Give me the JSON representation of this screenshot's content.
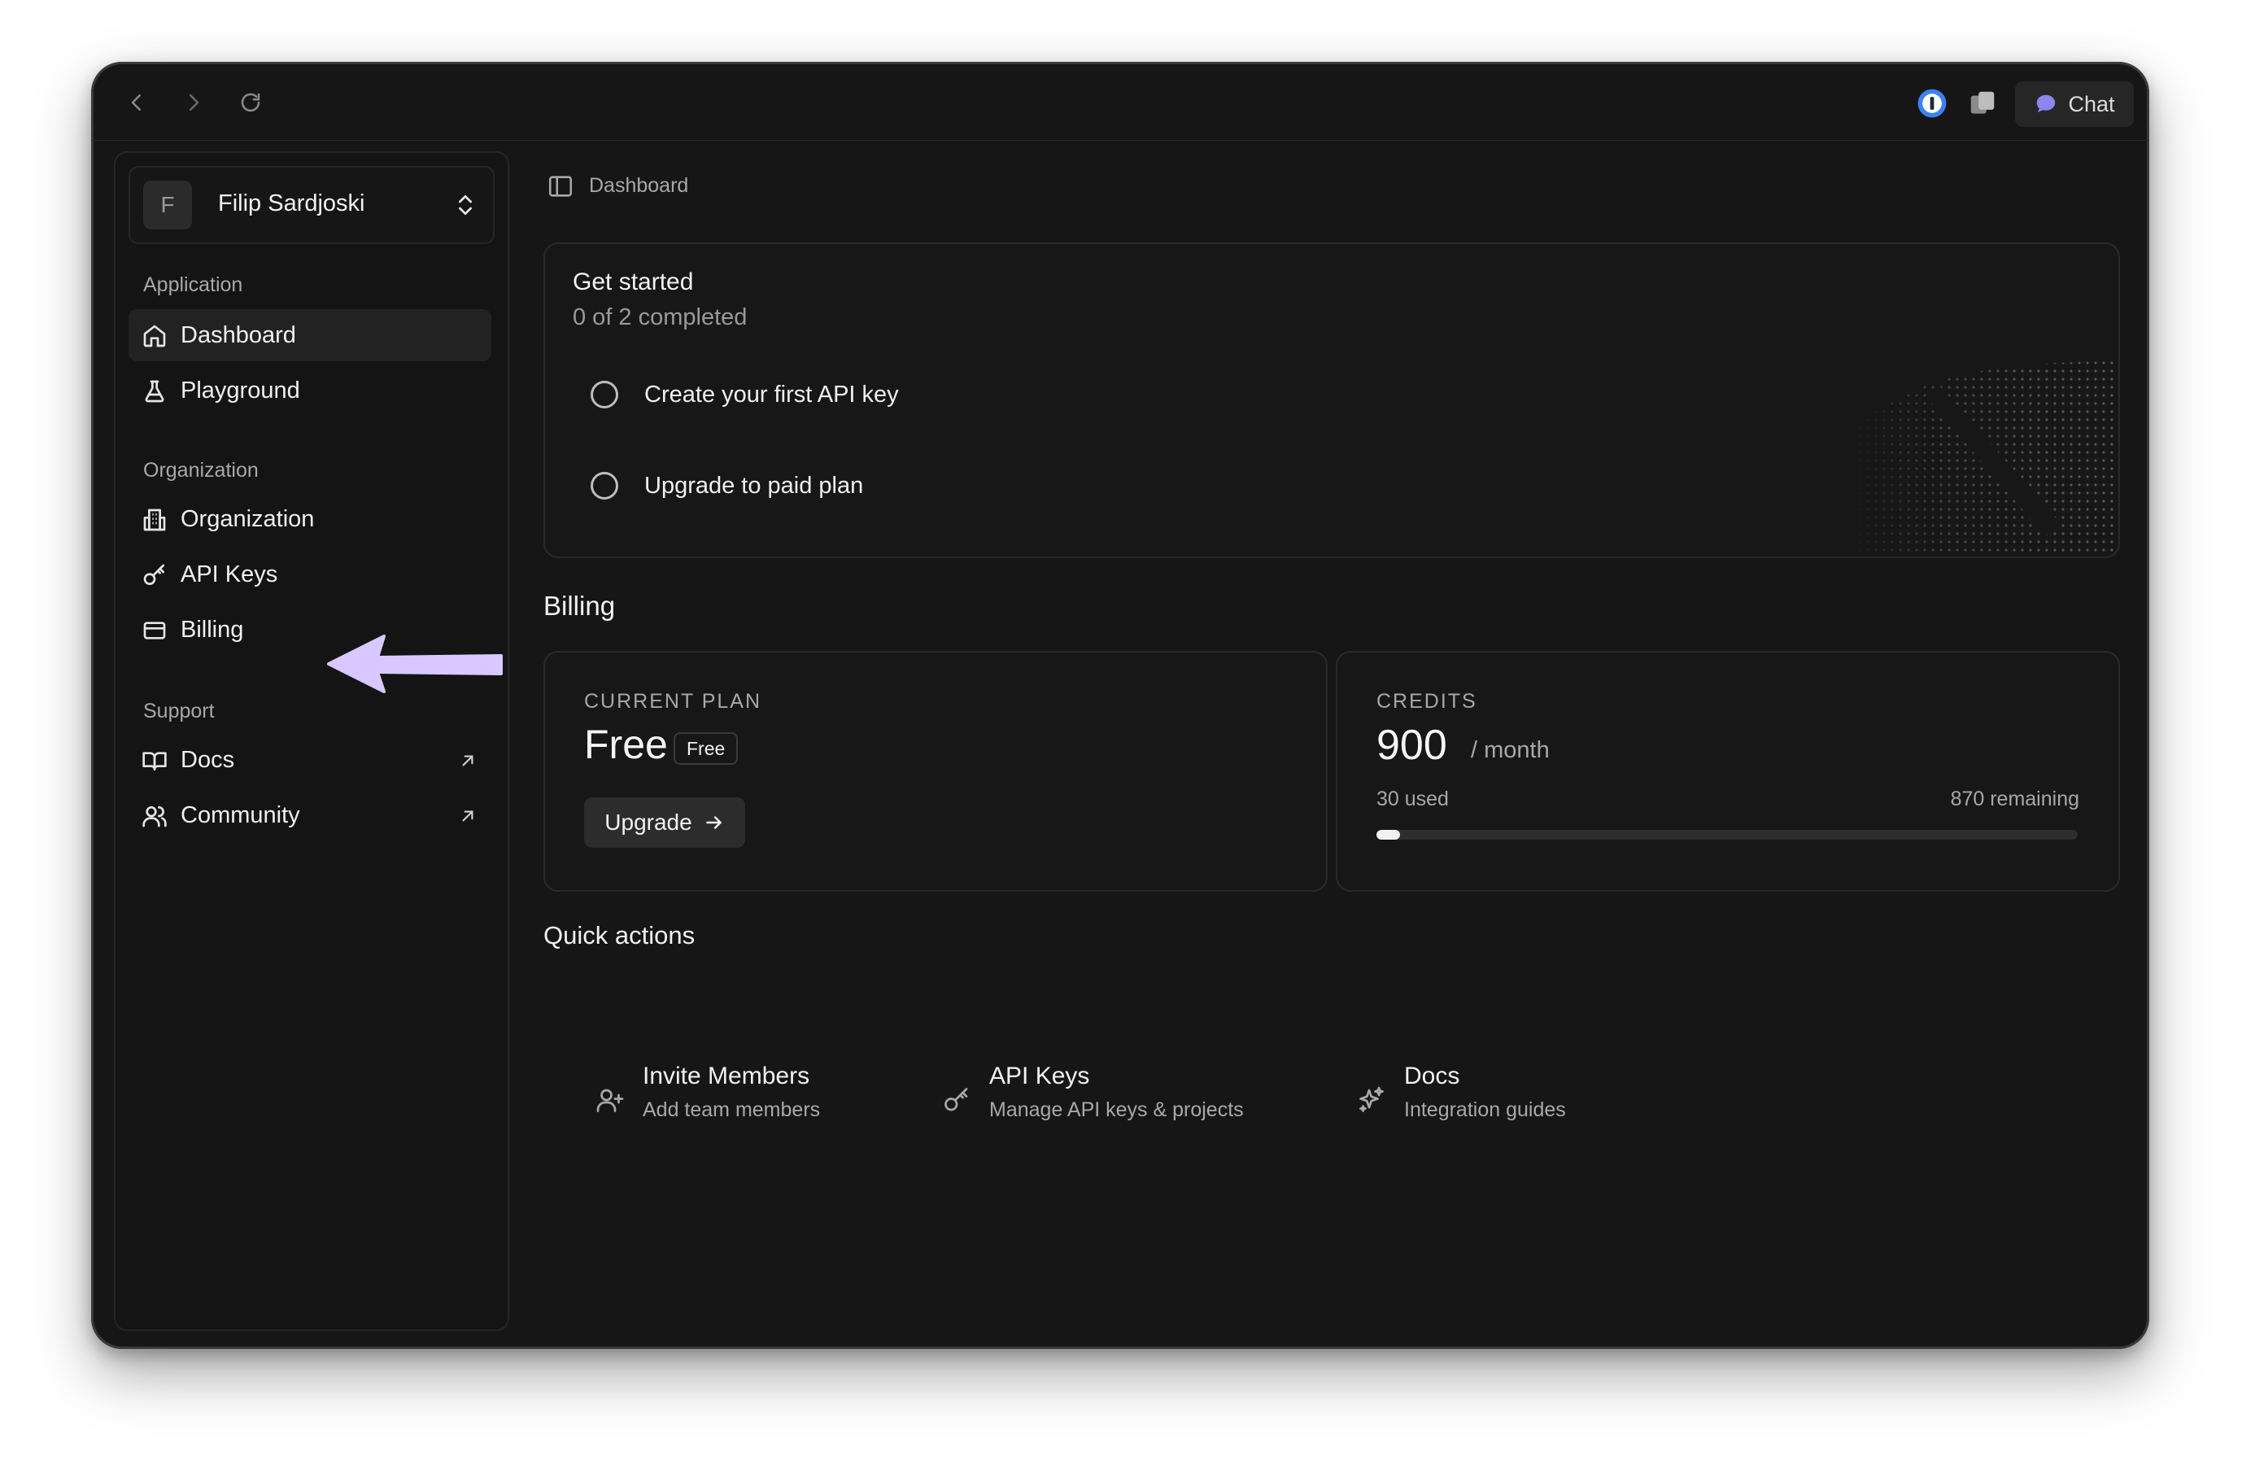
{
  "titlebar": {
    "chat_label": "Chat",
    "icons": [
      "chevron-left-icon",
      "chevron-right-icon",
      "reload-icon",
      "password-manager-icon",
      "extensions-icon",
      "chat-bubble-icon"
    ]
  },
  "sidebar": {
    "profile": {
      "initial": "F",
      "name": "Filip Sardjoski"
    },
    "sections": [
      {
        "label": "Application"
      },
      {
        "label": "Organization"
      },
      {
        "label": "Support"
      }
    ],
    "items": [
      {
        "label": "Dashboard",
        "icon": "home-icon",
        "active": true
      },
      {
        "label": "Playground",
        "icon": "flask-icon"
      },
      {
        "label": "Organization",
        "icon": "building-icon"
      },
      {
        "label": "API Keys",
        "icon": "key-icon"
      },
      {
        "label": "Billing",
        "icon": "credit-card-icon"
      },
      {
        "label": "Docs",
        "icon": "book-icon",
        "external": true
      },
      {
        "label": "Community",
        "icon": "users-icon",
        "external": true
      }
    ],
    "arrow_color": "#d9c8ff"
  },
  "breadcrumb": {
    "label": "Dashboard",
    "icon": "sidebar-toggle-icon"
  },
  "get_started": {
    "title": "Get started",
    "progress": "0 of 2 completed",
    "tasks": [
      {
        "label": "Create your first API key",
        "done": false
      },
      {
        "label": "Upgrade to paid plan",
        "done": false
      }
    ]
  },
  "billing": {
    "heading": "Billing",
    "plan": {
      "caption": "CURRENT PLAN",
      "name": "Free",
      "badge": "Free",
      "button": "Upgrade"
    },
    "credits": {
      "caption": "CREDITS",
      "amount": "900",
      "unit": "/ month",
      "used": "30 used",
      "remaining": "870 remaining",
      "used_fraction": 0.0333
    }
  },
  "quick_actions": {
    "heading": "Quick actions",
    "items": [
      {
        "title": "Invite Members",
        "desc": "Add team members",
        "icon": "user-plus-icon"
      },
      {
        "title": "API Keys",
        "desc": "Manage API keys & projects",
        "icon": "key-icon"
      },
      {
        "title": "Docs",
        "desc": "Integration guides",
        "icon": "sparkles-icon"
      }
    ]
  },
  "colors": {
    "background": "#161616",
    "card": "#171717",
    "accent_arrow": "#d9c8ff",
    "chat_icon": "#8b86f0",
    "password_icon": "#3b82f6"
  }
}
